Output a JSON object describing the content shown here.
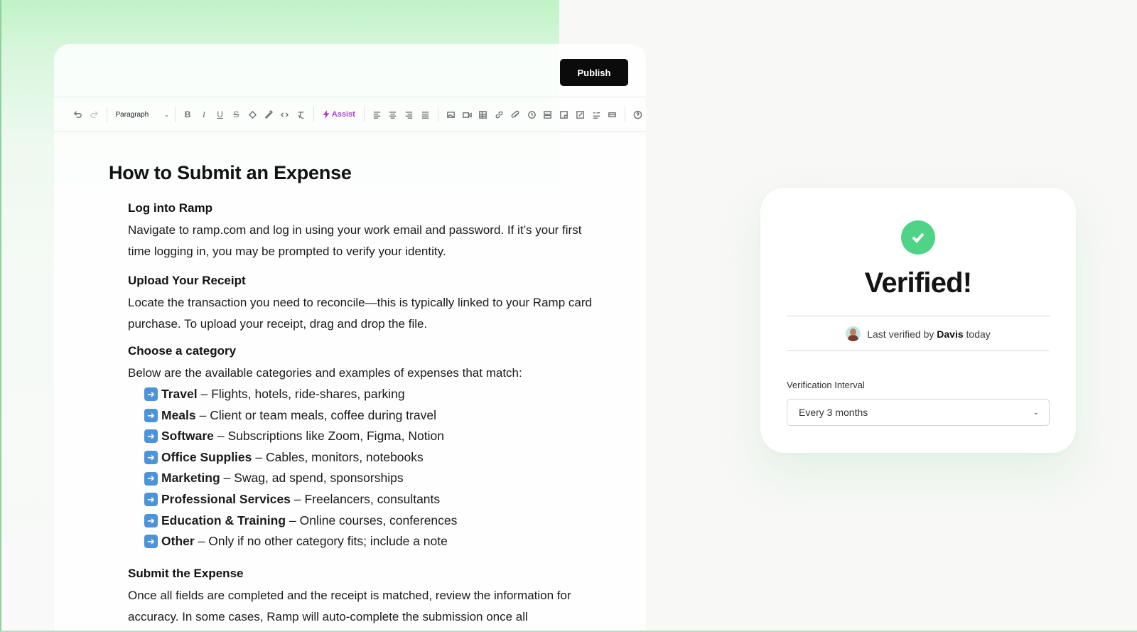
{
  "editor": {
    "publish_label": "Publish",
    "toolbar": {
      "block_format": "Paragraph",
      "assist_label": "Assist"
    },
    "doc_title": "How to Submit an Expense",
    "sections": [
      {
        "heading": "Log into Ramp",
        "body": "Navigate to ramp.com and log in using your work email and password. If it’s your first time logging in, you may be prompted to verify your identity."
      },
      {
        "heading": "Upload Your Receipt",
        "body": "Locate the transaction you need to reconcile—this is typically linked to your Ramp card purchase. To upload your receipt, drag and drop the file."
      },
      {
        "heading": "Choose a category",
        "body": "Below are the available categories and examples of expenses that match:"
      },
      {
        "heading": "Submit the Expense",
        "body": "Once all fields are completed and the receipt is matched, review the information for accuracy. In some cases, Ramp will auto-complete the submission once all"
      }
    ],
    "categories": [
      {
        "name": "Travel",
        "desc": "– Flights, hotels, ride-shares, parking"
      },
      {
        "name": "Meals",
        "desc": "– Client or team meals, coffee during travel"
      },
      {
        "name": "Software",
        "desc": "– Subscriptions like Zoom, Figma, Notion"
      },
      {
        "name": "Office Supplies",
        "desc": "– Cables, monitors, notebooks"
      },
      {
        "name": "Marketing",
        "desc": "– Swag, ad spend, sponsorships"
      },
      {
        "name": "Professional Services",
        "desc": "– Freelancers, consultants"
      },
      {
        "name": "Education & Training",
        "desc": "– Online courses, conferences"
      },
      {
        "name": "Other",
        "desc": "– Only if no other category fits; include a note"
      }
    ]
  },
  "verify_card": {
    "title": "Verified!",
    "last_verified_prefix": "Last verified by",
    "verifier": "Davis",
    "last_verified_suffix": "today",
    "interval_label": "Verification Interval",
    "interval_value": "Every 3 months"
  },
  "colors": {
    "accent_green": "#4fd387",
    "assist_purple": "#b23bd1",
    "publish_bg": "#0b0b0b"
  }
}
